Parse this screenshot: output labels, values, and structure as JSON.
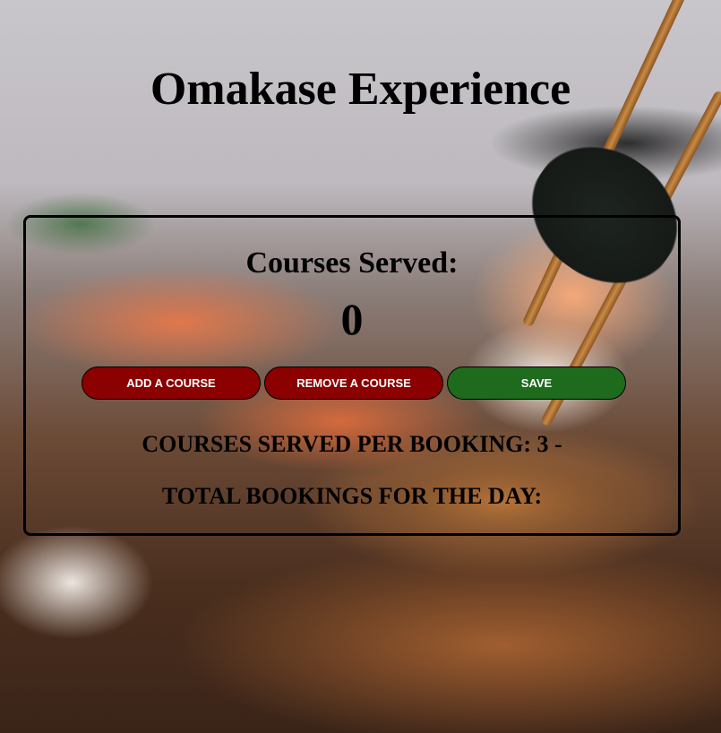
{
  "header": {
    "title": "Omakase Experience"
  },
  "counter": {
    "label": "Courses Served:",
    "value": "0"
  },
  "buttons": {
    "add_label": "ADD A COURSE",
    "remove_label": "REMOVE A COURSE",
    "save_label": "SAVE"
  },
  "info": {
    "per_booking": "COURSES SERVED PER BOOKING: 3 -",
    "total_bookings": "TOTAL BOOKINGS FOR THE DAY:"
  },
  "colors": {
    "add_button": "#8b0000",
    "remove_button": "#8b0000",
    "save_button": "#1e6b1e"
  }
}
